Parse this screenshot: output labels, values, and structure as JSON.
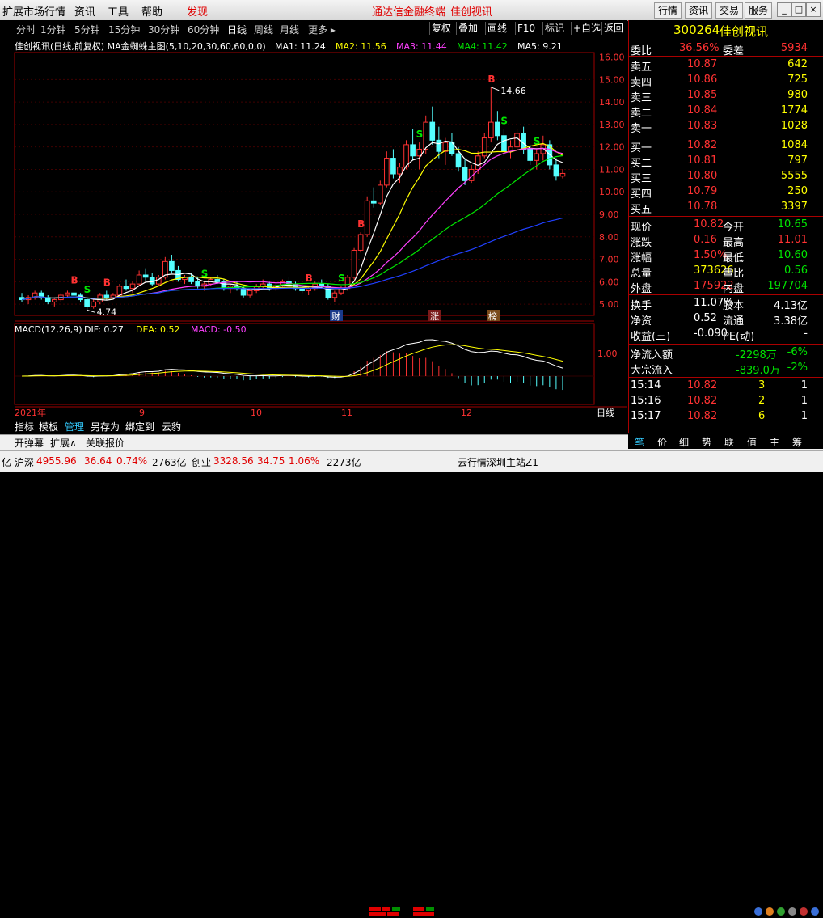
{
  "menubar": {
    "items": [
      "扩展市场行情",
      "资讯",
      "工具",
      "帮助"
    ],
    "discover": "发现",
    "promo1": "通达信金融终端",
    "promo2": "佳创视讯",
    "buttons": [
      "行情",
      "资讯",
      "交易",
      "服务"
    ],
    "win": [
      "_",
      "□",
      "×"
    ]
  },
  "periods": [
    "分时",
    "1分钟",
    "5分钟",
    "15分钟",
    "30分钟",
    "60分钟",
    "日线",
    "周线",
    "月线",
    "更多 ▸"
  ],
  "active_period": "日线",
  "toolbar_right": [
    "复权",
    "叠加",
    "画线",
    "F10",
    "标记",
    "+自选",
    "返回"
  ],
  "indicator_line": {
    "title": "佳创视讯(日线,前复权) MA金蜘蛛主图(5,10,20,30,60,60,0,0)",
    "ma1": "MA1: 11.24",
    "ma2": "MA2: 11.56",
    "ma3": "MA3: 11.44",
    "ma4": "MA4: 11.42",
    "ma5": "MA5: 9.21"
  },
  "price_axis": [
    "16.00",
    "15.00",
    "14.00",
    "13.00",
    "12.00",
    "11.00",
    "10.00",
    "9.00",
    "8.00",
    "7.00",
    "6.00",
    "5.00"
  ],
  "annotations": {
    "high": "14.66",
    "low": "4.74",
    "cai": "财",
    "zhang": "涨",
    "bang": "榜"
  },
  "signals": [
    "B",
    "S",
    "B",
    "S",
    "B",
    "S",
    "B",
    "S",
    "B",
    "S",
    "S"
  ],
  "macd_line": {
    "title": "MACD(12,26,9)",
    "dif": "DIF: 0.27",
    "dea": "DEA: 0.52",
    "macd": "MACD: -0.50"
  },
  "macd_axis": [
    "1.00"
  ],
  "date_axis": {
    "year": "2021年",
    "months": [
      "9",
      "10",
      "11",
      "12"
    ],
    "period": "日线"
  },
  "bottom_tabs": [
    "指标",
    "模板",
    "管理",
    "另存为",
    "绑定到",
    "云豹"
  ],
  "bottom_tabs2": [
    "开弹幕",
    "扩展∧",
    "关联报价"
  ],
  "stock": {
    "code": "300264",
    "name": "佳创视讯"
  },
  "order": {
    "wei_bi_label": "委比",
    "wei_bi": "36.56%",
    "wei_cha_label": "委差",
    "wei_cha": "5934",
    "sells": [
      {
        "label": "卖五",
        "price": "10.87",
        "vol": "642"
      },
      {
        "label": "卖四",
        "price": "10.86",
        "vol": "725"
      },
      {
        "label": "卖三",
        "price": "10.85",
        "vol": "980"
      },
      {
        "label": "卖二",
        "price": "10.84",
        "vol": "1774"
      },
      {
        "label": "卖一",
        "price": "10.83",
        "vol": "1028"
      }
    ],
    "buys": [
      {
        "label": "买一",
        "price": "10.82",
        "vol": "1084"
      },
      {
        "label": "买二",
        "price": "10.81",
        "vol": "797"
      },
      {
        "label": "买三",
        "price": "10.80",
        "vol": "5555"
      },
      {
        "label": "买四",
        "price": "10.79",
        "vol": "250"
      },
      {
        "label": "买五",
        "price": "10.78",
        "vol": "3397"
      }
    ]
  },
  "quote": [
    {
      "l1": "现价",
      "v1": "10.82",
      "c1": "red",
      "l2": "今开",
      "v2": "10.65",
      "c2": "green"
    },
    {
      "l1": "涨跌",
      "v1": "0.16",
      "c1": "red",
      "l2": "最高",
      "v2": "11.01",
      "c2": "red"
    },
    {
      "l1": "涨幅",
      "v1": "1.50%",
      "c1": "red",
      "l2": "最低",
      "v2": "10.60",
      "c2": "green"
    },
    {
      "l1": "总量",
      "v1": "373626",
      "c1": "yellow",
      "l2": "量比",
      "v2": "0.56",
      "c2": "green"
    },
    {
      "l1": "外盘",
      "v1": "175922",
      "c1": "red",
      "l2": "内盘",
      "v2": "197704",
      "c2": "green"
    }
  ],
  "finance": [
    {
      "l1": "换手",
      "v1": "11.07%",
      "l2": "股本",
      "v2": "4.13亿"
    },
    {
      "l1": "净资",
      "v1": "0.52",
      "l2": "流通",
      "v2": "3.38亿"
    },
    {
      "l1": "收益(三)",
      "v1": "-0.090",
      "l2": "PE(动)",
      "v2": "-"
    }
  ],
  "flow": [
    {
      "label": "净流入额",
      "value": "-2298万",
      "pct": "-6%"
    },
    {
      "label": "大宗流入",
      "value": "-839.0万",
      "pct": "-2%"
    }
  ],
  "ticks": [
    {
      "time": "15:14",
      "price": "10.82",
      "vol": "3",
      "n": "1"
    },
    {
      "time": "15:16",
      "price": "10.82",
      "vol": "2",
      "n": "1"
    },
    {
      "time": "15:17",
      "price": "10.82",
      "vol": "6",
      "n": "1"
    }
  ],
  "right_tabs": [
    "笔",
    "价",
    "细",
    "势",
    "联",
    "值",
    "主",
    "筹"
  ],
  "status": {
    "yi": "亿",
    "hs_label": "沪深",
    "hs_val": "4955.96",
    "hs_chg": "36.64",
    "hs_pct": "0.74%",
    "hs_amt": "2763亿",
    "cy_label": "创业",
    "cy_val": "3328.56",
    "cy_chg": "34.75",
    "cy_pct": "1.06%",
    "cy_amt": "2273亿",
    "server": "云行情深圳主站Z1"
  },
  "chart_data": {
    "type": "candlestick",
    "ylim": [
      4.5,
      16.2
    ],
    "ticks": [
      5,
      6,
      7,
      8,
      9,
      10,
      11,
      12,
      13,
      14,
      15,
      16
    ],
    "ohlc": [
      [
        5.3,
        5.5,
        5.1,
        5.2
      ],
      [
        5.2,
        5.4,
        5.0,
        5.3
      ],
      [
        5.3,
        5.6,
        5.2,
        5.5
      ],
      [
        5.5,
        5.6,
        5.2,
        5.3
      ],
      [
        5.3,
        5.4,
        5.0,
        5.1
      ],
      [
        5.1,
        5.3,
        4.9,
        5.2
      ],
      [
        5.2,
        5.5,
        5.1,
        5.4
      ],
      [
        5.4,
        5.6,
        5.3,
        5.5
      ],
      [
        5.5,
        5.7,
        5.3,
        5.4
      ],
      [
        5.4,
        5.5,
        5.1,
        5.2
      ],
      [
        5.2,
        5.3,
        4.74,
        4.9
      ],
      [
        4.9,
        5.2,
        4.8,
        5.1
      ],
      [
        5.1,
        5.5,
        5.0,
        5.4
      ],
      [
        5.4,
        5.6,
        5.2,
        5.3
      ],
      [
        5.3,
        5.5,
        5.2,
        5.4
      ],
      [
        5.4,
        5.9,
        5.3,
        5.8
      ],
      [
        5.8,
        6.1,
        5.6,
        5.7
      ],
      [
        5.7,
        6.0,
        5.5,
        5.9
      ],
      [
        5.9,
        6.5,
        5.8,
        6.3
      ],
      [
        6.3,
        6.6,
        6.0,
        6.2
      ],
      [
        6.2,
        6.4,
        5.8,
        5.9
      ],
      [
        5.9,
        6.3,
        5.8,
        6.2
      ],
      [
        6.2,
        7.1,
        6.1,
        6.9
      ],
      [
        6.9,
        7.2,
        6.4,
        6.5
      ],
      [
        6.5,
        6.7,
        6.0,
        6.1
      ],
      [
        6.1,
        6.3,
        5.9,
        6.2
      ],
      [
        6.2,
        6.4,
        5.9,
        6.0
      ],
      [
        6.0,
        6.2,
        5.7,
        5.8
      ],
      [
        5.8,
        6.0,
        5.6,
        5.9
      ],
      [
        5.9,
        6.2,
        5.8,
        6.1
      ],
      [
        6.1,
        6.3,
        5.9,
        6.0
      ],
      [
        6.0,
        6.1,
        5.6,
        5.7
      ],
      [
        5.7,
        5.9,
        5.5,
        5.8
      ],
      [
        5.8,
        6.0,
        5.6,
        5.7
      ],
      [
        5.7,
        5.8,
        5.3,
        5.4
      ],
      [
        5.4,
        5.7,
        5.3,
        5.6
      ],
      [
        5.6,
        5.9,
        5.5,
        5.8
      ],
      [
        5.8,
        6.1,
        5.7,
        5.9
      ],
      [
        5.9,
        6.0,
        5.6,
        5.7
      ],
      [
        5.7,
        5.9,
        5.6,
        5.8
      ],
      [
        5.8,
        6.1,
        5.7,
        6.0
      ],
      [
        6.0,
        6.2,
        5.8,
        5.9
      ],
      [
        5.9,
        6.0,
        5.6,
        5.7
      ],
      [
        5.7,
        5.9,
        5.5,
        5.6
      ],
      [
        5.6,
        5.8,
        5.4,
        5.7
      ],
      [
        5.7,
        6.0,
        5.6,
        5.9
      ],
      [
        5.9,
        6.1,
        5.7,
        5.8
      ],
      [
        5.8,
        5.9,
        5.2,
        5.3
      ],
      [
        5.3,
        5.6,
        5.1,
        5.5
      ],
      [
        5.5,
        5.8,
        5.4,
        5.7
      ],
      [
        5.7,
        6.3,
        5.6,
        6.2
      ],
      [
        6.2,
        7.5,
        6.1,
        7.4
      ],
      [
        7.4,
        8.2,
        7.3,
        8.1
      ],
      [
        8.1,
        9.8,
        8.0,
        9.6
      ],
      [
        9.6,
        10.2,
        9.3,
        9.5
      ],
      [
        9.5,
        10.5,
        9.4,
        10.3
      ],
      [
        10.3,
        11.8,
        10.2,
        11.5
      ],
      [
        11.5,
        11.9,
        10.6,
        10.8
      ],
      [
        10.8,
        11.3,
        10.4,
        11.1
      ],
      [
        11.1,
        12.3,
        11.0,
        12.1
      ],
      [
        12.1,
        12.8,
        11.4,
        11.6
      ],
      [
        11.6,
        12.2,
        11.0,
        11.9
      ],
      [
        11.9,
        13.4,
        11.7,
        13.1
      ],
      [
        13.1,
        13.8,
        12.1,
        12.3
      ],
      [
        12.3,
        12.9,
        11.5,
        11.8
      ],
      [
        11.8,
        12.4,
        11.2,
        12.2
      ],
      [
        12.2,
        12.6,
        11.6,
        11.7
      ],
      [
        11.7,
        12.0,
        10.9,
        11.1
      ],
      [
        11.1,
        11.5,
        10.3,
        10.5
      ],
      [
        10.5,
        11.2,
        10.4,
        11.0
      ],
      [
        11.0,
        11.8,
        10.8,
        11.6
      ],
      [
        11.6,
        12.6,
        11.5,
        12.4
      ],
      [
        12.4,
        14.66,
        12.2,
        13.1
      ],
      [
        13.1,
        13.6,
        12.3,
        12.5
      ],
      [
        12.5,
        12.8,
        11.6,
        11.8
      ],
      [
        11.8,
        12.3,
        11.5,
        12.0
      ],
      [
        12.0,
        12.8,
        11.8,
        12.6
      ],
      [
        12.6,
        12.9,
        11.7,
        11.9
      ],
      [
        11.9,
        12.1,
        11.2,
        11.4
      ],
      [
        11.4,
        11.9,
        11.0,
        11.7
      ],
      [
        11.7,
        12.5,
        11.4,
        12.1
      ],
      [
        12.1,
        12.3,
        11.0,
        11.2
      ],
      [
        11.2,
        11.5,
        10.5,
        10.7
      ],
      [
        10.7,
        11.01,
        10.6,
        10.82
      ]
    ]
  }
}
